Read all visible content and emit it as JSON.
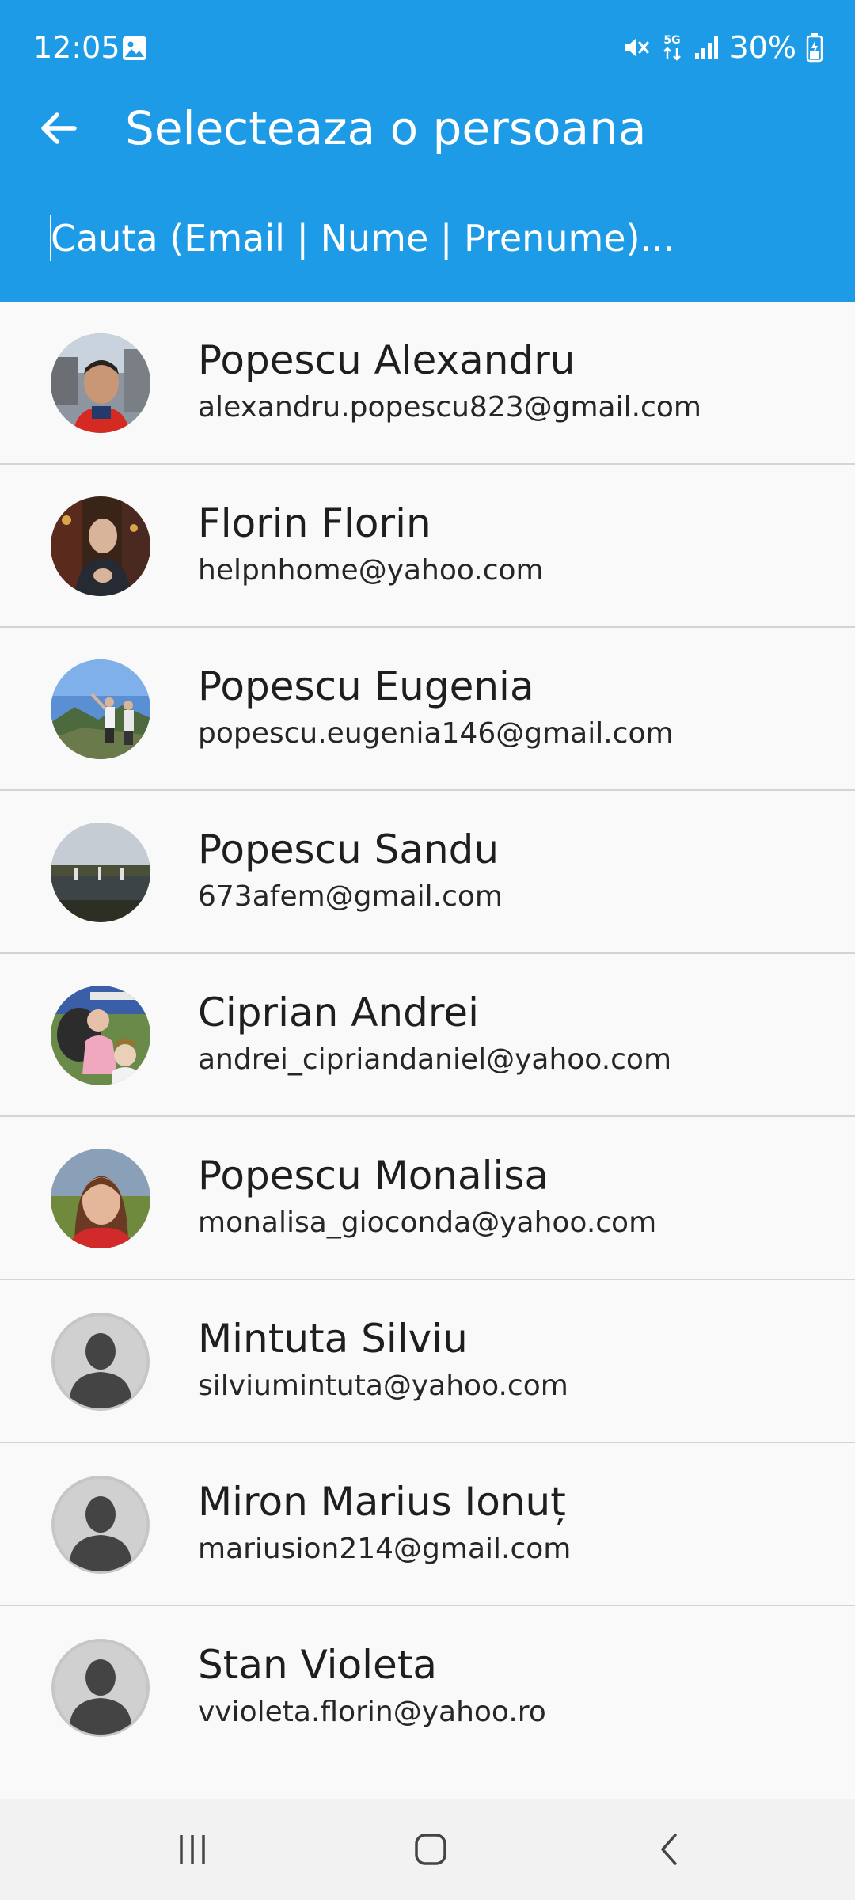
{
  "status_bar": {
    "time": "12:05",
    "battery_percent": "30%",
    "network_label": "5G",
    "icons": [
      "gallery-icon",
      "mute-icon",
      "5g-data-icon",
      "signal-icon",
      "battery-charging-icon"
    ]
  },
  "header": {
    "back_icon": "arrow-left-icon",
    "title": "Selecteaza o persoana"
  },
  "search": {
    "placeholder": "Cauta (Email | Nume | Prenume)...",
    "value": ""
  },
  "contacts": [
    {
      "name": "Popescu Alexandru",
      "email": "alexandru.popescu823@gmail.com",
      "avatar": "photo"
    },
    {
      "name": "Florin Florin",
      "email": "helpnhome@yahoo.com",
      "avatar": "photo"
    },
    {
      "name": "Popescu Eugenia",
      "email": "popescu.eugenia146@gmail.com",
      "avatar": "photo"
    },
    {
      "name": "Popescu Sandu",
      "email": "673afem@gmail.com",
      "avatar": "photo"
    },
    {
      "name": "Ciprian Andrei",
      "email": "andrei_cipriandaniel@yahoo.com",
      "avatar": "photo"
    },
    {
      "name": "Popescu Monalisa",
      "email": "monalisa_gioconda@yahoo.com",
      "avatar": "photo"
    },
    {
      "name": "Mintuta Silviu",
      "email": "silviumintuta@yahoo.com",
      "avatar": "default-person-icon"
    },
    {
      "name": "Miron Marius Ionuț",
      "email": "mariusion214@gmail.com",
      "avatar": "default-person-icon"
    },
    {
      "name": "Stan Violeta",
      "email": "vvioleta.florin@yahoo.ro",
      "avatar": "default-person-icon"
    }
  ],
  "nav_bar": {
    "icons": [
      "recent-apps-icon",
      "home-icon",
      "back-icon"
    ]
  },
  "colors": {
    "app_bar": "#1d9be6",
    "list_background": "#f9f9f9",
    "divider": "#d4d4d4",
    "nav_bar": "#f2f2f2"
  }
}
